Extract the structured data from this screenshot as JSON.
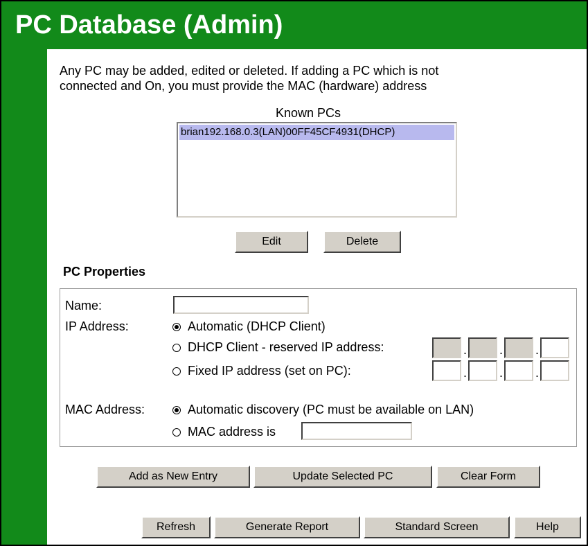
{
  "header": {
    "title": "PC Database (Admin)"
  },
  "intro": {
    "line1": "Any PC may be added, edited or deleted. If adding a PC which is not",
    "line2": "connected and On, you must provide the MAC (hardware) address"
  },
  "known_pcs": {
    "label": "Known PCs",
    "items": [
      {
        "text": "brian192.168.0.3(LAN)00FF45CF4931(DHCP)",
        "selected": true
      }
    ]
  },
  "list_buttons": {
    "edit": "Edit",
    "delete": "Delete"
  },
  "pc_properties": {
    "title": "PC Properties",
    "name_label": "Name:",
    "name_value": "",
    "ip_label": "IP Address:",
    "ip_options": {
      "automatic": "Automatic (DHCP Client)",
      "reserved": "DHCP Client - reserved IP address:",
      "fixed": "Fixed IP address (set on PC):"
    },
    "ip_selected": "automatic",
    "mac_label": "MAC Address:",
    "mac_options": {
      "auto": "Automatic discovery (PC must be available on LAN)",
      "manual": "MAC address is"
    },
    "mac_selected": "auto",
    "mac_value": ""
  },
  "form_buttons": {
    "add": "Add as New Entry",
    "update": "Update Selected PC",
    "clear": "Clear Form"
  },
  "footer_buttons": {
    "refresh": "Refresh",
    "report": "Generate Report",
    "standard": "Standard Screen",
    "help": "Help"
  },
  "colors": {
    "header_green": "#128a1a",
    "selection": "#b8b9ee",
    "button_face": "#d4d0c8"
  }
}
